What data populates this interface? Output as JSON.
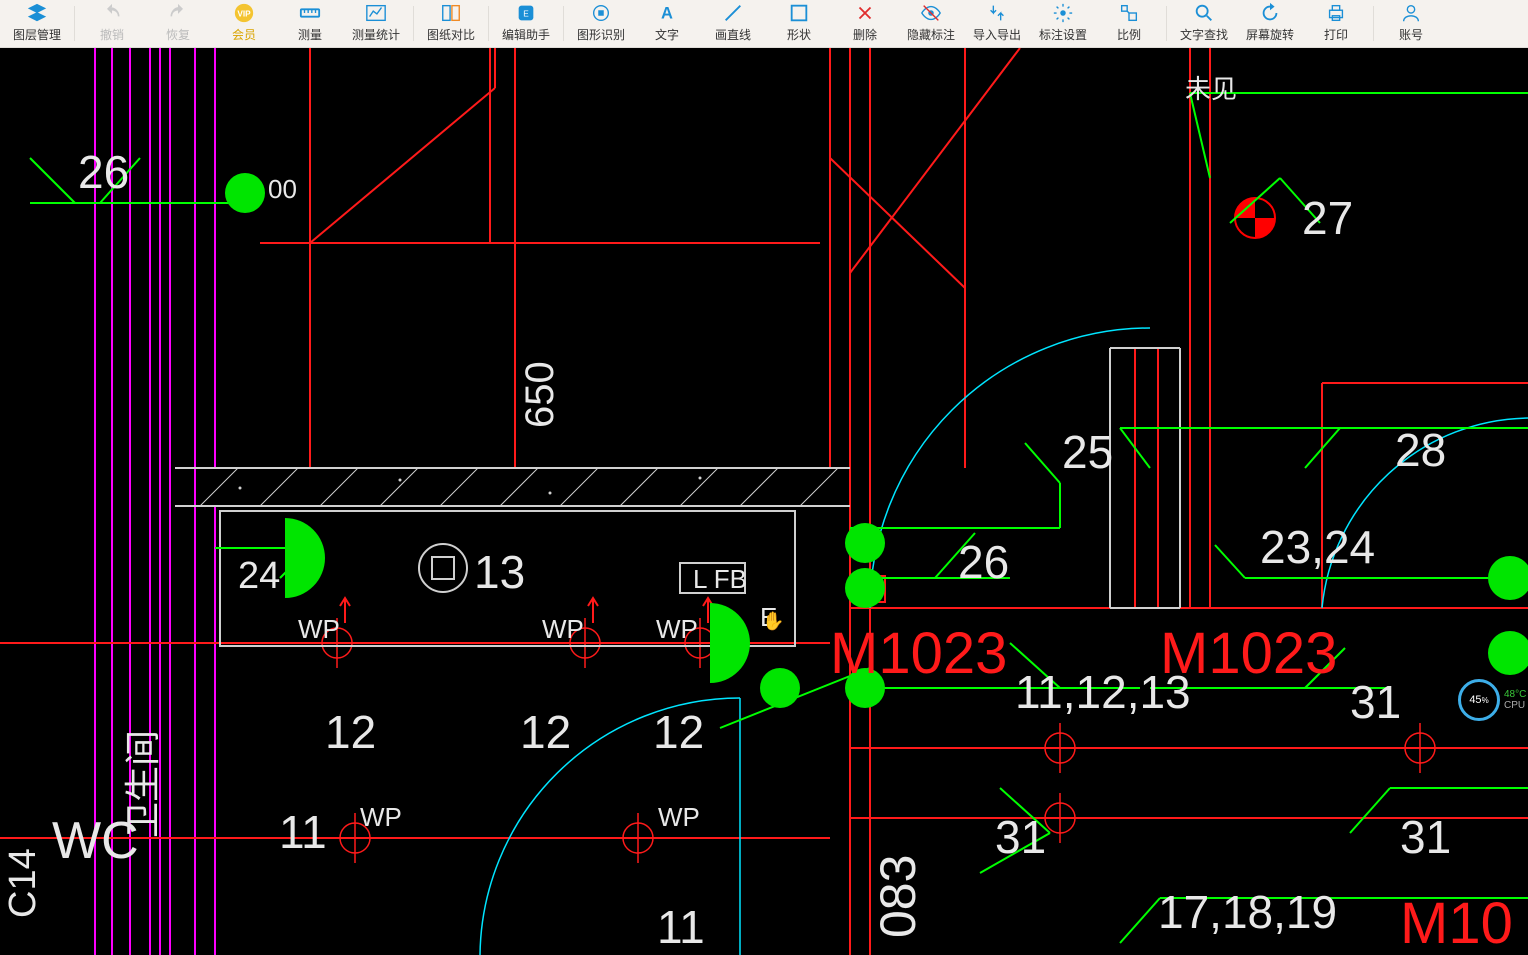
{
  "toolbar": {
    "items": [
      {
        "id": "layer-manager",
        "label": "图层管理",
        "icon": "layers"
      },
      {
        "id": "undo",
        "label": "撤销",
        "icon": "undo",
        "disabled": true
      },
      {
        "id": "redo",
        "label": "恢复",
        "icon": "redo",
        "disabled": true
      },
      {
        "id": "vip",
        "label": "会员",
        "icon": "vip",
        "vip": true
      },
      {
        "id": "measure",
        "label": "测量",
        "icon": "measure"
      },
      {
        "id": "measure-stats",
        "label": "测量统计",
        "icon": "measure-stats"
      },
      {
        "id": "compare",
        "label": "图纸对比",
        "icon": "compare"
      },
      {
        "id": "edit-assist",
        "label": "编辑助手",
        "icon": "edit-assist"
      },
      {
        "id": "shape-recog",
        "label": "图形识别",
        "icon": "shape-recog"
      },
      {
        "id": "text",
        "label": "文字",
        "icon": "text"
      },
      {
        "id": "line",
        "label": "画直线",
        "icon": "line"
      },
      {
        "id": "shape",
        "label": "形状",
        "icon": "shape"
      },
      {
        "id": "delete",
        "label": "删除",
        "icon": "delete"
      },
      {
        "id": "hide-annot",
        "label": "隐藏标注",
        "icon": "hide"
      },
      {
        "id": "import-export",
        "label": "导入导出",
        "icon": "io"
      },
      {
        "id": "annot-settings",
        "label": "标注设置",
        "icon": "settings"
      },
      {
        "id": "scale",
        "label": "比例",
        "icon": "scale"
      },
      {
        "id": "text-search",
        "label": "文字查找",
        "icon": "search"
      },
      {
        "id": "rotate",
        "label": "屏幕旋转",
        "icon": "rotate"
      },
      {
        "id": "print",
        "label": "打印",
        "icon": "print"
      },
      {
        "id": "account",
        "label": "账号",
        "icon": "account"
      }
    ]
  },
  "drawing": {
    "labels": {
      "n26_tl": "26",
      "n26_mid": "26",
      "n27": "27",
      "n25": "25",
      "n28": "28",
      "n23_24": "23,24",
      "n13": "13",
      "n12a": "12",
      "n12b": "12",
      "n12c": "12",
      "n11": "11",
      "n11b": "11",
      "n31a": "31",
      "n31b": "31",
      "n31c": "31",
      "n11_12_13": "11,12,13",
      "n17_18_19": "17,18,19",
      "m1023a": "M1023",
      "m1023b": "M1023",
      "m10": "M10",
      "t083": "083",
      "t650": "650",
      "t00": "00",
      "wc": "WC",
      "l_fb": "L FB",
      "e_": "E",
      "wp": "WP",
      "chinese_top": "未见",
      "chinese_left": "卫生间",
      "c14": "C14"
    }
  },
  "system": {
    "percent": "45",
    "percent_suffix": "%",
    "temp": "48°C",
    "cpu": "CPU"
  }
}
